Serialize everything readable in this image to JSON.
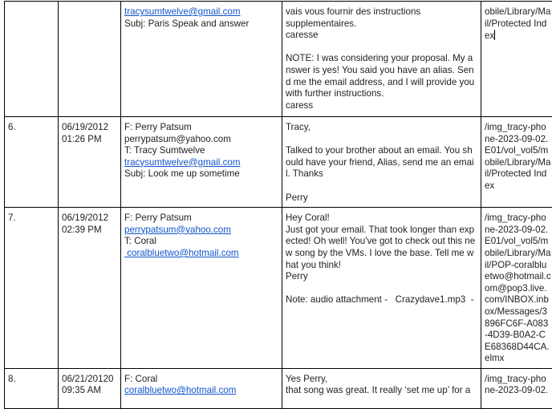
{
  "rows": [
    {
      "num": "",
      "date": [],
      "from_lines": [
        {
          "text": "tracysumtwelve@gmail.com",
          "link": true
        },
        {
          "text": "Subj: Paris Speak and answer",
          "link": false
        }
      ],
      "body_lines": [
        "vais vous fournir des instructions",
        "supplementaires.",
        "caresse",
        "",
        "NOTE: I was considering your proposal. My answer is yes! You said you have an alias. Send me the email address, and I will provide you with further instructions.",
        "caress"
      ],
      "path": "obile/Library/Mail/Protected Index"
    },
    {
      "num": "6.",
      "date": [
        "06/19/2012",
        "01:26 PM"
      ],
      "from_lines": [
        {
          "text": "F: Perry Patsum",
          "link": false
        },
        {
          "text": "perrypatsum@yahoo.com",
          "link": false
        },
        {
          "text": "T: Tracy Sumtwelve",
          "link": false
        },
        {
          "text": "tracysumtwelve@gmail.com",
          "link": true
        },
        {
          "text": "Subj: Look me up sometime",
          "link": false
        }
      ],
      "body_lines": [
        "Tracy,",
        "",
        "Talked to your brother about an email. You should have your friend, Alias, send me an email. Thanks",
        "",
        "Perry"
      ],
      "path": "/img_tracy-phone-2023-09-02.E01/vol_vol5/mobile/Library/Mail/Protected Index"
    },
    {
      "num": "7.",
      "date": [
        "06/19/2012",
        "02:39 PM"
      ],
      "from_lines": [
        {
          "text": "F: Perry Patsum",
          "link": false
        },
        {
          "text": "perrypatsum@yahoo.com",
          "link": true
        },
        {
          "text": "T: Coral",
          "link": false
        },
        {
          "text": " coralbluetwo@hotmail.com",
          "link": true
        }
      ],
      "body_lines": [
        "Hey Coral!",
        "Just got your email. That took longer than expected! Oh well! You've got to check out this new song by the VMs. I love the base. Tell me what you think!",
        "Perry",
        "",
        "Note: audio attachment -   Crazydave1.mp3  -"
      ],
      "path": "/img_tracy-phone-2023-09-02.E01/vol_vol5/mobile/Library/Mail/POP-coralbluetwo@hotmail.com@pop3.live.com/INBOX.inbox/Messages/3896FC6F-A083-4D39-B0A2-CE68368D44CA.elmx"
    },
    {
      "num": "8.",
      "date": [
        "06/21/20120",
        "09:35 AM"
      ],
      "from_lines": [
        {
          "text": "F: Coral",
          "link": false
        },
        {
          "text": "coralbluetwo@hotmail.com",
          "link": true
        }
      ],
      "body_lines": [
        "Yes Perry,",
        "that song was great. It really ‘set me up’ for a"
      ],
      "path": "/img_tracy-phone-2023-09-02."
    }
  ]
}
